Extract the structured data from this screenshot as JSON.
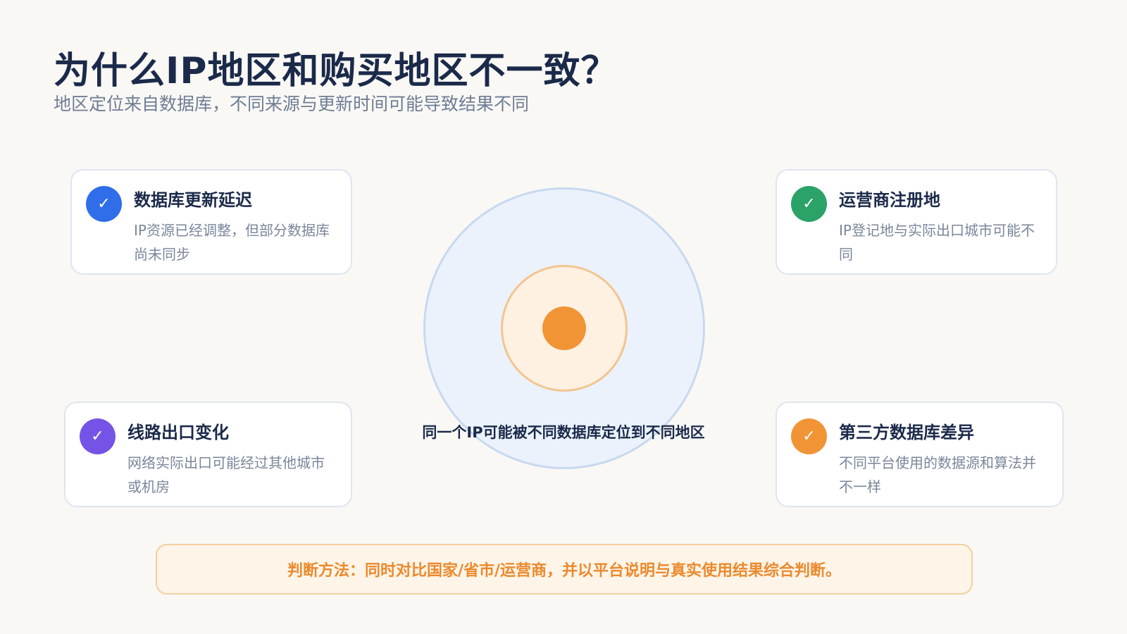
{
  "header": {
    "title": "为什么IP地区和购买地区不一致？",
    "subtitle": "地区定位来自数据库，不同来源与更新时间可能导致结果不同"
  },
  "cards": [
    {
      "title": "数据库更新延迟",
      "desc": "IP资源已经调整，但部分数据库尚未同步",
      "color": "#2f6ee8",
      "icon": "check-icon"
    },
    {
      "title": "运营商注册地",
      "desc": "IP登记地与实际出口城市可能不同",
      "color": "#2aa268",
      "icon": "check-icon"
    },
    {
      "title": "线路出口变化",
      "desc": "网络实际出口可能经过其他城市或机房",
      "color": "#7453e6",
      "icon": "check-icon"
    },
    {
      "title": "第三方数据库差异",
      "desc": "不同平台使用的数据源和算法并不一样",
      "color": "#f19435",
      "icon": "check-icon"
    }
  ],
  "check_glyph": "✓",
  "center": {
    "label": "同一个IP可能被不同数据库定位到不同地区",
    "colors": {
      "outer": "#ebf2fc",
      "middle": "#fef1e2",
      "core": "#f19435"
    }
  },
  "method": {
    "text": "判断方法：同时对比国家/省市/运营商，并以平台说明与真实使用结果综合判断。"
  }
}
